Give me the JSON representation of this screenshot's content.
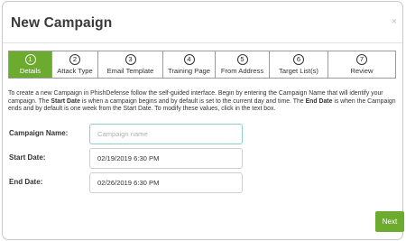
{
  "dialog": {
    "title": "New Campaign",
    "close_symbol": "×"
  },
  "steps": [
    {
      "number": "1",
      "label": "Details",
      "active": true
    },
    {
      "number": "2",
      "label": "Attack Type",
      "active": false
    },
    {
      "number": "3",
      "label": "Email Template",
      "active": false
    },
    {
      "number": "4",
      "label": "Training Page",
      "active": false
    },
    {
      "number": "5",
      "label": "From Address",
      "active": false
    },
    {
      "number": "6",
      "label": "Target List(s)",
      "active": false
    },
    {
      "number": "7",
      "label": "Review",
      "active": false
    }
  ],
  "description": {
    "part1": "To create a new Campaign in PhishDefense follow the self-guided interface. Begin by entering the Campaign Name that will identify your campaign. The ",
    "start_date_term": "Start Date",
    "part2": " is when a campaign begins and by default is set to the current day and time. The ",
    "end_date_term": "End Date",
    "part3": " is when the Campaign ends and by default is one week from the Start Date. To modify these values, click in the text box."
  },
  "form": {
    "campaign_name": {
      "label": "Campaign Name:",
      "placeholder": "Campaign name",
      "value": ""
    },
    "start_date": {
      "label": "Start Date:",
      "value": "02/19/2019 6:30 PM"
    },
    "end_date": {
      "label": "End Date:",
      "value": "02/26/2019 6:30 PM"
    }
  },
  "footer": {
    "next_label": "Next"
  },
  "colors": {
    "accent": "#6dab2f",
    "focus_border": "#8fd0c4"
  }
}
